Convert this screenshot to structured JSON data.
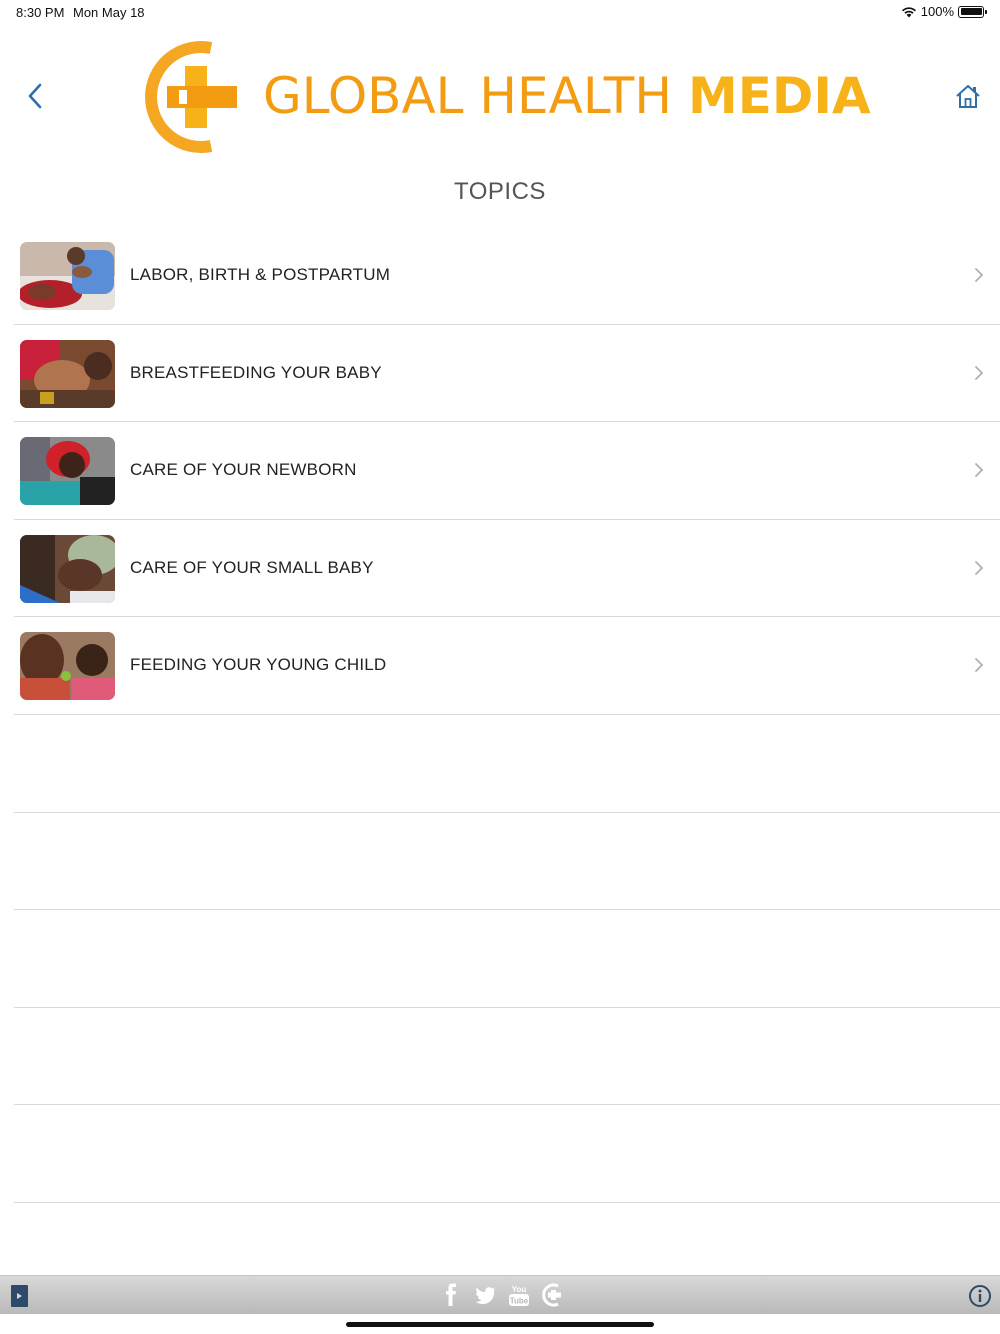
{
  "status_bar": {
    "time": "8:30 PM",
    "date": "Mon May 18",
    "battery": "100%"
  },
  "header": {
    "logo_light": "GLOBAL HEALTH",
    "logo_bold": "MEDIA",
    "brand_color": "#f5a623",
    "back_icon": "chevron-left-icon",
    "home_icon": "home-icon"
  },
  "page_title": "TOPICS",
  "topics": [
    {
      "label": "LABOR, BIRTH & POSTPARTUM"
    },
    {
      "label": "BREASTFEEDING YOUR BABY"
    },
    {
      "label": "CARE OF YOUR NEWBORN"
    },
    {
      "label": "CARE OF YOUR SMALL BABY"
    },
    {
      "label": "FEEDING YOUR YOUNG CHILD"
    }
  ],
  "toolbar": {
    "left_icon": "book-icon",
    "social_icons": [
      "facebook-icon",
      "twitter-icon",
      "youtube-icon",
      "ghm-logo-icon"
    ],
    "right_icon": "info-icon"
  }
}
